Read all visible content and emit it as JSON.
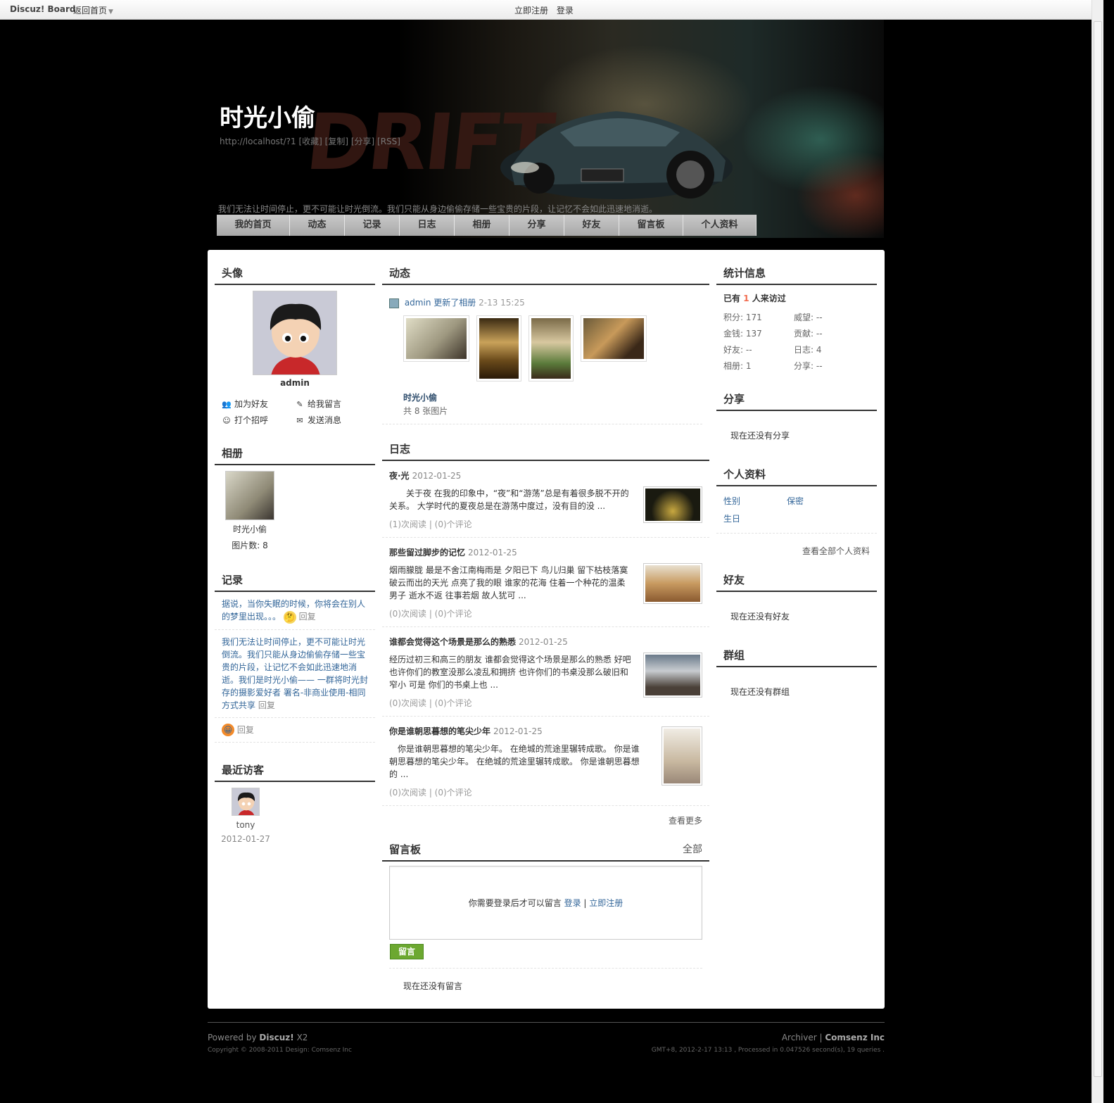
{
  "topbar": {
    "brand": "Discuz! Board",
    "home": "返回首页",
    "register": "立即注册",
    "login": "登录"
  },
  "banner": {
    "title": "时光小偷",
    "url": "http://localhost/?1 [收藏] [复制] [分享] [RSS]",
    "logo_text": "DRIFT",
    "desc": "我们无法让时间停止，更不可能让时光倒流。我们只能从身边偷偷存储一些宝贵的片段，让记忆不会如此迅速地消逝。"
  },
  "nav": [
    "我的首页",
    "动态",
    "记录",
    "日志",
    "相册",
    "分享",
    "好友",
    "留言板",
    "个人资料"
  ],
  "left": {
    "avatar_title": "头像",
    "username": "admin",
    "actions": [
      {
        "label": "加为好友",
        "icon": "add-friend-icon"
      },
      {
        "label": "给我留言",
        "icon": "pencil-icon"
      },
      {
        "label": "打个招呼",
        "icon": "poke-icon"
      },
      {
        "label": "发送消息",
        "icon": "envelope-icon"
      }
    ],
    "album_title": "相册",
    "album_name": "时光小偷",
    "album_count": "图片数: 8",
    "records_title": "记录",
    "records": [
      {
        "text": "据说，当你失眠的时候，你将会在别人的梦里出现。。。",
        "reply": "回复"
      },
      {
        "text": "我们无法让时间停止，更不可能让时光倒流。我们只能从身边偷偷存储一些宝贵的片段，让记忆不会如此迅速地消逝。我们是时光小偷—— 一群将时光封存的摄影爱好者 署名-非商业使用-相同方式共享",
        "reply": "回复"
      },
      {
        "text": "",
        "reply": "回复"
      }
    ],
    "visitors_title": "最近访客",
    "visitor_name": "tony",
    "visitor_date": "2012-01-27"
  },
  "center": {
    "feed_title": "动态",
    "feed_user": "admin",
    "feed_action": "更新了相册",
    "feed_time": "2-13 15:25",
    "feed_album": "时光小偷",
    "feed_count": "共 8 张图片",
    "blog_title": "日志",
    "blogs": [
      {
        "title": "夜·光",
        "date": "2012-01-25",
        "body": "　　关于夜 在我的印象中，“夜”和“游荡”总是有着很多脱不开的关系。 大学时代的夏夜总是在游荡中度过，没有目的没 ...",
        "reads": "(1)次阅读",
        "comments": "(0)个评论"
      },
      {
        "title": "那些留过脚步的记忆",
        "date": "2012-01-25",
        "body": "烟雨朦胧 最是不舍江南梅雨是 夕阳已下 鸟儿归巢 留下枯枝落寞 破云而出的天光 点亮了我的眼 谁家的花海 住着一个种花的温柔男子 逝水不返 往事若烟 故人犹可 ...",
        "reads": "(0)次阅读",
        "comments": "(0)个评论"
      },
      {
        "title": "谁都会觉得这个场景是那么的熟悉",
        "date": "2012-01-25",
        "body": "经历过初三和高三的朋友 谁都会觉得这个场景是那么的熟悉 好吧 也许你们的教室没那么凌乱和拥挤 也许你们的书桌没那么破旧和窄小 可是 你们的书桌上也 ...",
        "reads": "(0)次阅读",
        "comments": "(0)个评论"
      },
      {
        "title": "你是谁朝思暮想的笔尖少年",
        "date": "2012-01-25",
        "body": "　你是谁朝思暮想的笔尖少年。 在绝城的荒途里辗转成歌。 你是谁朝思暮想的笔尖少年。 在绝城的荒途里辗转成歌。 你是谁朝思暮想的 ...",
        "reads": "(0)次阅读",
        "comments": "(0)个评论"
      }
    ],
    "more": "查看更多",
    "board_title": "留言板",
    "board_all": "全部",
    "board_prompt": "你需要登录后才可以留言",
    "board_login": "登录",
    "board_register": "立即注册",
    "board_button": "留言",
    "board_empty": "现在还没有留言"
  },
  "right": {
    "stats_title": "统计信息",
    "visits_prefix": "已有",
    "visits_num": "1",
    "visits_suffix": "人来访过",
    "stats": [
      {
        "label": "积分",
        "value": "171"
      },
      {
        "label": "威望",
        "value": "--"
      },
      {
        "label": "金钱",
        "value": "137"
      },
      {
        "label": "贡献",
        "value": "--"
      },
      {
        "label": "好友",
        "value": "--"
      },
      {
        "label": "日志",
        "value": "4"
      },
      {
        "label": "相册",
        "value": "1"
      },
      {
        "label": "分享",
        "value": "--"
      }
    ],
    "share_title": "分享",
    "share_empty": "现在还没有分享",
    "profile_title": "个人资料",
    "gender_label": "性别",
    "gender_value": "保密",
    "birthday_label": "生日",
    "profile_more": "查看全部个人资料",
    "friends_title": "好友",
    "friends_empty": "现在还没有好友",
    "groups_title": "群组",
    "groups_empty": "现在还没有群组"
  },
  "footer": {
    "powered_prefix": "Powered by",
    "powered_product": "Discuz!",
    "powered_version": "X2",
    "copyright": "Copyright © 2008-2011 Design: Comsenz Inc",
    "archiver": "Archiver",
    "company": "Comsenz Inc",
    "stats": "GMT+8, 2012-2-17 13:13 , Processed in 0.047526 second(s), 19 queries ."
  },
  "colors": {
    "nav_bg": "#b8b8b8",
    "accent": "#336699",
    "button_green": "#6ca830",
    "visits_highlight": "#f26c4f"
  }
}
